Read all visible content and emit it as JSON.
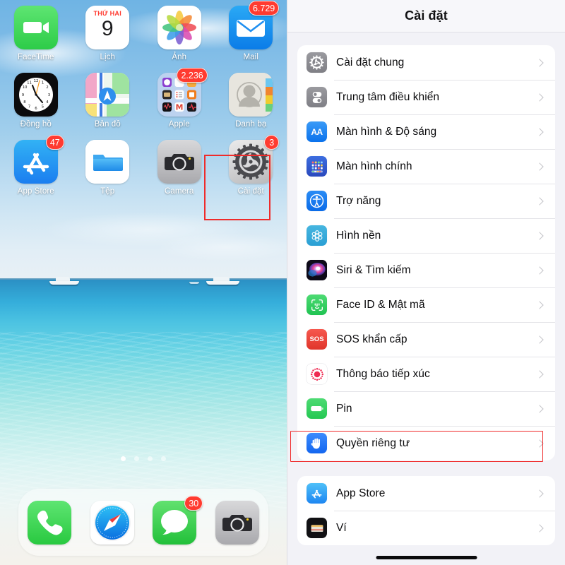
{
  "home_screen": {
    "wallpaper_description": "tropical beach with turquoise sea and boats",
    "page_dots": {
      "count": 4,
      "active_index": 0
    },
    "apps": [
      {
        "name": "FaceTime",
        "label": "FaceTime",
        "icon": "facetime-icon",
        "badge": null
      },
      {
        "name": "Calendar",
        "label": "Lịch",
        "icon": "calendar-icon",
        "badge": null,
        "weekday": "THỨ HAI",
        "day": "9"
      },
      {
        "name": "Photos",
        "label": "Ảnh",
        "icon": "photos-icon",
        "badge": null
      },
      {
        "name": "Mail",
        "label": "Mail",
        "icon": "mail-icon",
        "badge": "6.729"
      },
      {
        "name": "Clock",
        "label": "Đồng hồ",
        "icon": "clock-icon",
        "badge": null
      },
      {
        "name": "Maps",
        "label": "Bản đồ",
        "icon": "maps-icon",
        "badge": null
      },
      {
        "name": "Apple folder",
        "label": "Apple",
        "icon": "folder-icon",
        "badge": "2.236"
      },
      {
        "name": "Contacts",
        "label": "Danh bạ",
        "icon": "contacts-icon",
        "badge": null
      },
      {
        "name": "App Store",
        "label": "App Store",
        "icon": "appstore-icon",
        "badge": "47"
      },
      {
        "name": "Files",
        "label": "Tệp",
        "icon": "files-icon",
        "badge": null
      },
      {
        "name": "Camera",
        "label": "Camera",
        "icon": "camera-icon",
        "badge": null
      },
      {
        "name": "Settings",
        "label": "Cài đặt",
        "icon": "settings-gear-icon",
        "badge": "3",
        "highlighted": true
      }
    ],
    "dock": [
      {
        "name": "Phone",
        "icon": "phone-icon",
        "badge": null
      },
      {
        "name": "Safari",
        "icon": "safari-compass-icon",
        "badge": null
      },
      {
        "name": "Messages",
        "icon": "messages-bubble-icon",
        "badge": "30"
      },
      {
        "name": "Camera",
        "icon": "camera-icon",
        "badge": null
      }
    ]
  },
  "settings_screen": {
    "title": "Cài đặt",
    "groups": [
      {
        "rows": [
          {
            "label": "Cài đặt chung",
            "icon": "gear-icon"
          },
          {
            "label": "Trung tâm điều khiển",
            "icon": "control-center-icon"
          },
          {
            "label": "Màn hình & Độ sáng",
            "icon": "display-brightness-icon",
            "glyph": "AA"
          },
          {
            "label": "Màn hình chính",
            "icon": "home-screen-icon"
          },
          {
            "label": "Trợ năng",
            "icon": "accessibility-icon"
          },
          {
            "label": "Hình nền",
            "icon": "wallpaper-icon"
          },
          {
            "label": "Siri & Tìm kiếm",
            "icon": "siri-icon"
          },
          {
            "label": "Face ID & Mật mã",
            "icon": "faceid-icon"
          },
          {
            "label": "SOS khẩn cấp",
            "icon": "sos-icon",
            "glyph": "SOS"
          },
          {
            "label": "Thông báo tiếp xúc",
            "icon": "exposure-notification-icon"
          },
          {
            "label": "Pin",
            "icon": "battery-icon"
          },
          {
            "label": "Quyền riêng tư",
            "icon": "privacy-hand-icon",
            "highlighted": true
          }
        ]
      },
      {
        "rows": [
          {
            "label": "App Store",
            "icon": "appstore-icon"
          },
          {
            "label": "Ví",
            "icon": "wallet-icon"
          }
        ]
      }
    ]
  },
  "colors": {
    "highlight_red": "#ef2b2b",
    "badge_red": "#ff3b30",
    "settings_bg": "#f2f2f7",
    "row_bg": "#ffffff",
    "separator": "#e4e4e8",
    "accent_blue": "#0a72ec"
  }
}
